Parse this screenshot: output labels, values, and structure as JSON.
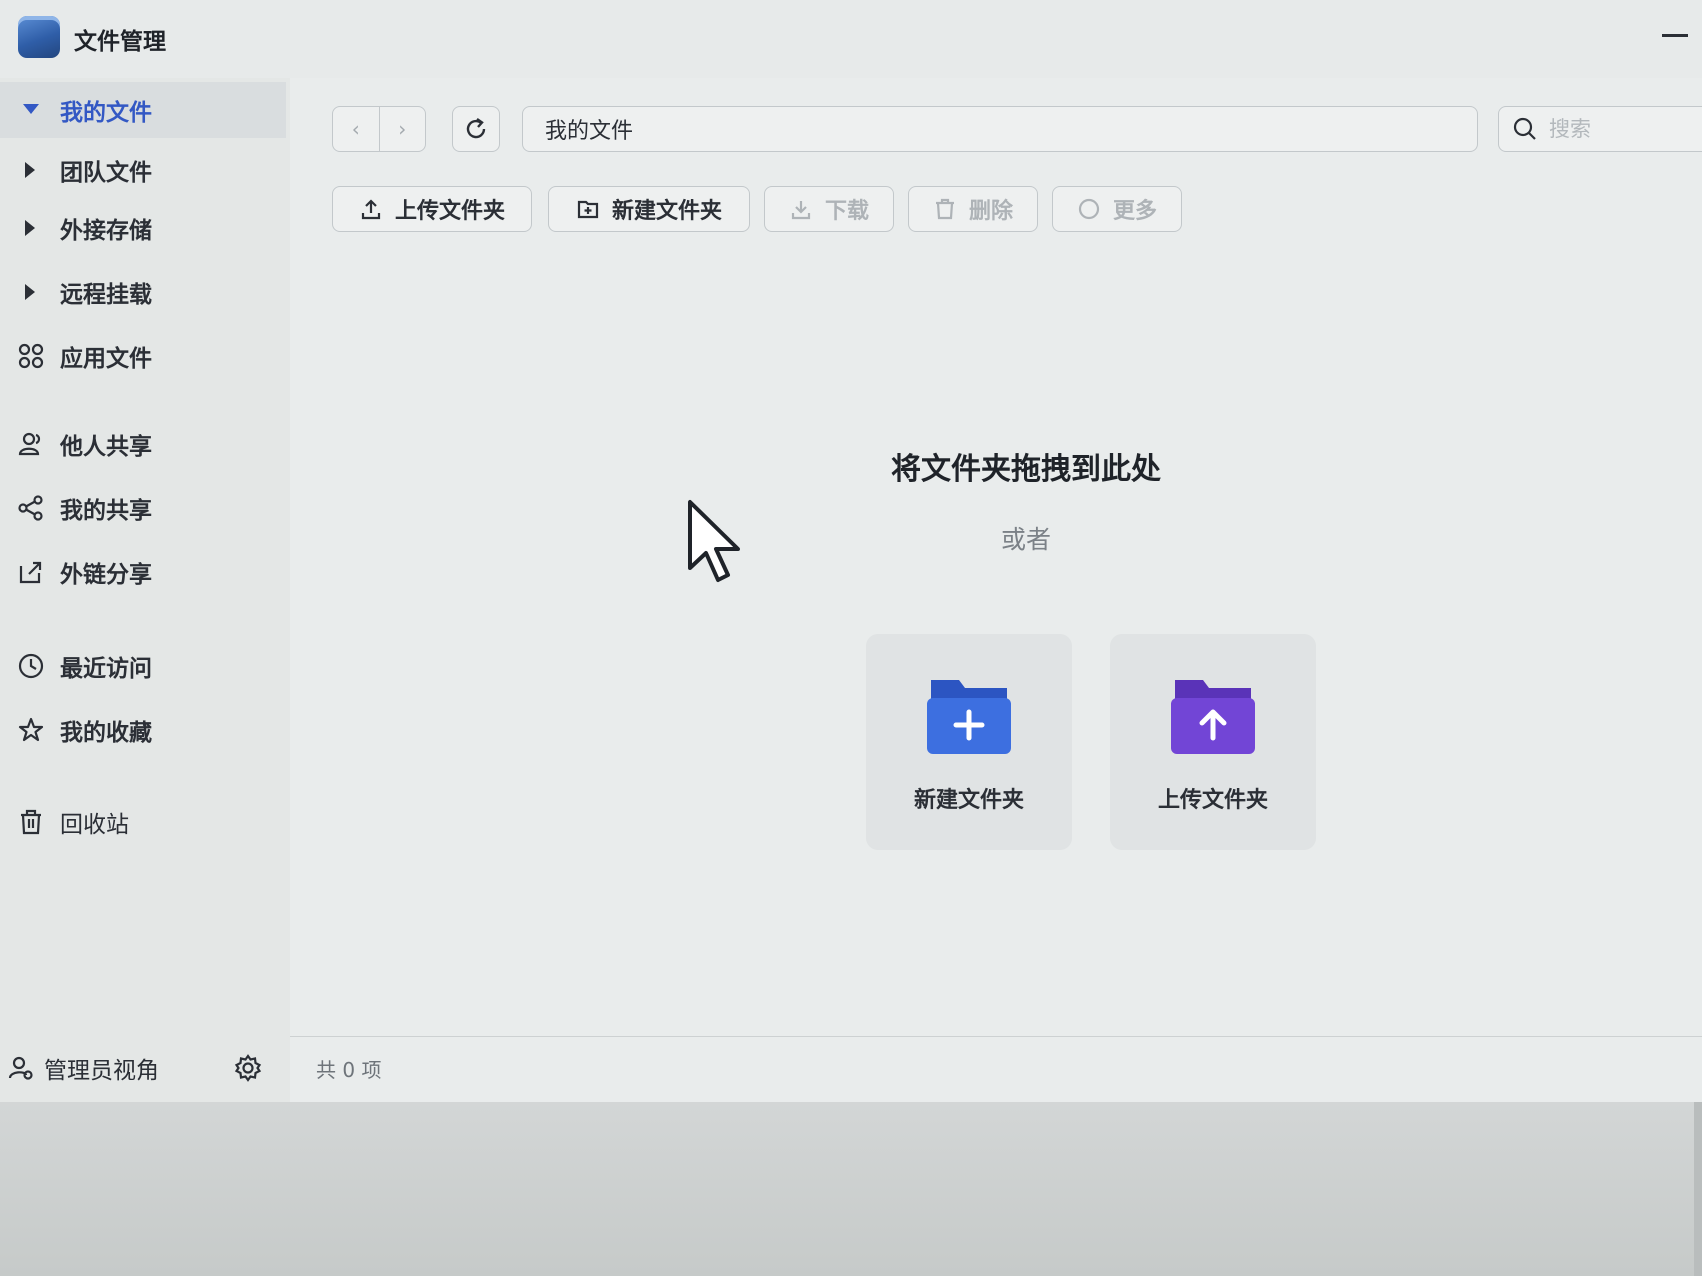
{
  "app": {
    "title": "文件管理"
  },
  "sidebar": {
    "items": [
      {
        "label": "我的文件",
        "icon": "caret-down-icon",
        "active": true
      },
      {
        "label": "团队文件",
        "icon": "caret-right-icon"
      },
      {
        "label": "外接存储",
        "icon": "caret-right-icon"
      },
      {
        "label": "远程挂载",
        "icon": "caret-right-icon"
      },
      {
        "label": "应用文件",
        "icon": "apps-grid-icon"
      },
      {
        "label": "他人共享",
        "icon": "users-icon"
      },
      {
        "label": "我的共享",
        "icon": "share-icon"
      },
      {
        "label": "外链分享",
        "icon": "external-link-icon"
      },
      {
        "label": "最近访问",
        "icon": "clock-icon"
      },
      {
        "label": "我的收藏",
        "icon": "star-icon"
      },
      {
        "label": "回收站",
        "icon": "trash-icon"
      }
    ],
    "footer": {
      "label": "管理员视角",
      "icon": "admin-user-icon",
      "settings_icon": "gear-icon"
    }
  },
  "nav": {
    "back_glyph": "‹",
    "forward_glyph": "›",
    "path": "我的文件",
    "search_placeholder": "搜索"
  },
  "toolbar": {
    "upload_folder": "上传文件夹",
    "new_folder": "新建文件夹",
    "download": "下载",
    "delete": "删除",
    "more": "更多"
  },
  "empty_state": {
    "title": "将文件夹拖拽到此处",
    "or": "或者",
    "cards": [
      {
        "label": "新建文件夹",
        "color": "#3d6fe0"
      },
      {
        "label": "上传文件夹",
        "color": "#7245d6"
      }
    ]
  },
  "status": {
    "count": "共 0 项"
  },
  "colors": {
    "accent": "#3358c4"
  }
}
